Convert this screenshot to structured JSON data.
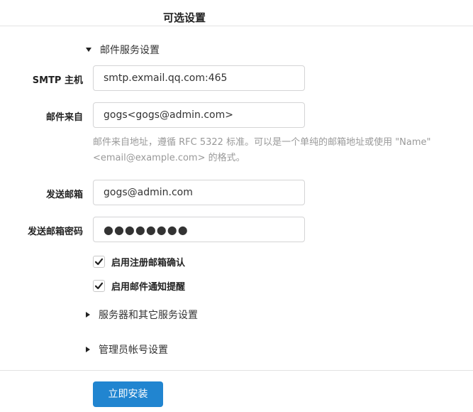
{
  "header": {
    "title": "可选设置"
  },
  "mail_section": {
    "toggle_label": "邮件服务设置",
    "expanded": true,
    "smtp_host": {
      "label": "SMTP 主机",
      "value": "smtp.exmail.qq.com:465"
    },
    "mail_from": {
      "label": "邮件来自",
      "value": "gogs<gogs@admin.com>",
      "help_line1": "邮件来自地址，遵循 RFC 5322 标准。可以是一个单纯的邮箱地址或使用 \"Name\"",
      "help_line2": "<email@example.com> 的格式。"
    },
    "sender_email": {
      "label": "发送邮箱",
      "value": "gogs@admin.com"
    },
    "sender_password": {
      "label": "发送邮箱密码",
      "value": "●●●●●●●●"
    },
    "register_confirm": {
      "label": "启用注册邮箱确认",
      "checked": true
    },
    "mail_notify": {
      "label": "启用邮件通知提醒",
      "checked": true
    }
  },
  "server_section": {
    "toggle_label": "服务器和其它服务设置",
    "expanded": false
  },
  "admin_section": {
    "toggle_label": "管理员帐号设置",
    "expanded": false
  },
  "actions": {
    "install_label": "立即安装"
  },
  "colors": {
    "primary": "#2185d0",
    "help_text": "#999999",
    "border": "#d4d4d5"
  }
}
